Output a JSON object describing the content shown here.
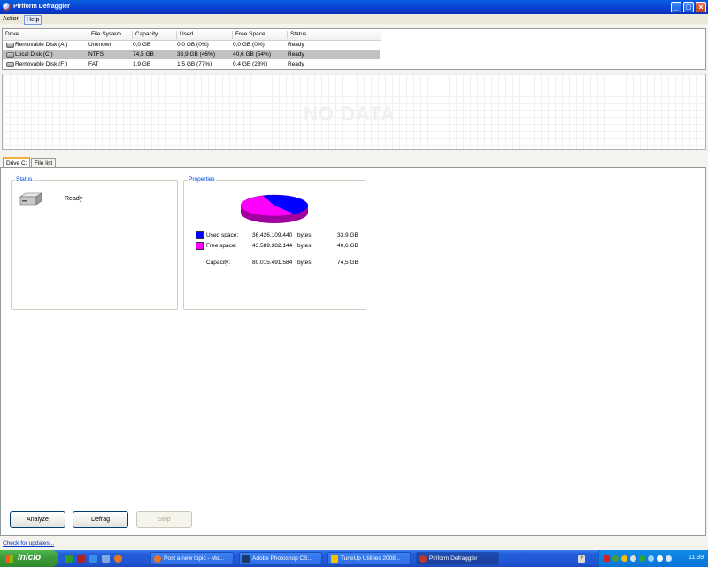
{
  "window": {
    "title": "Piriform Defraggler",
    "controls": {
      "minimize": "_",
      "maximize": "□",
      "close": "×"
    }
  },
  "menu": [
    "Action",
    "Help"
  ],
  "drive_table": {
    "headers": [
      "Drive",
      "File System",
      "Capacity",
      "Used",
      "Free Space",
      "Status"
    ],
    "rows": [
      {
        "drive": "Removable Disk (A:)",
        "fs": "Unknown",
        "capacity": "0,0 GB",
        "used": "0,0 GB (0%)",
        "free": "0,0 GB (0%)",
        "status": "Ready",
        "icon": "floppy-drive-icon"
      },
      {
        "drive": "Local Disk (C:)",
        "fs": "NTFS",
        "capacity": "74,5 GB",
        "used": "33,9 GB (46%)",
        "free": "40,6 GB (54%)",
        "status": "Ready",
        "icon": "hard-disk-icon"
      },
      {
        "drive": "Removable Disk (F:)",
        "fs": "FAT",
        "capacity": "1,9 GB",
        "used": "1,5 GB (77%)",
        "free": "0,4 GB (23%)",
        "status": "Ready",
        "icon": "removable-disk-icon"
      }
    ]
  },
  "graph": {
    "placeholder": "NO DATA"
  },
  "tabs": [
    "Drive C:",
    "File list"
  ],
  "status_group": {
    "title": "Status",
    "state": "Ready"
  },
  "properties_group": {
    "title": "Properties",
    "used": {
      "label": "Used space:",
      "bytes": "36.426.109.440",
      "unit": "bytes",
      "size": "33,9 GB",
      "color": "#0000ff",
      "fraction": 0.455
    },
    "free": {
      "label": "Free space:",
      "bytes": "43.589.382.144",
      "unit": "bytes",
      "size": "40,6 GB",
      "color": "#ff00ff",
      "fraction": 0.545
    },
    "capacity": {
      "label": "Capacity:",
      "bytes": "80.015.491.584",
      "unit": "bytes",
      "size": "74,5 GB"
    }
  },
  "buttons": {
    "analyze": "Analyze",
    "defrag": "Defrag",
    "stop": "Stop"
  },
  "footer": {
    "updates_link": "Check for updates..."
  },
  "taskbar": {
    "start": "Inicio",
    "tasks": [
      {
        "label": "Post a new topic - Mo...",
        "icon": "firefox-icon"
      },
      {
        "label": "Adobe Photoshop CS...",
        "icon": "photoshop-icon"
      },
      {
        "label": "TuneUp Utilities 2008...",
        "icon": "tuneup-icon"
      },
      {
        "label": "Piriform Defraggler",
        "icon": "defraggler-icon"
      }
    ],
    "help_glyph": "?",
    "clock": "11:39"
  }
}
